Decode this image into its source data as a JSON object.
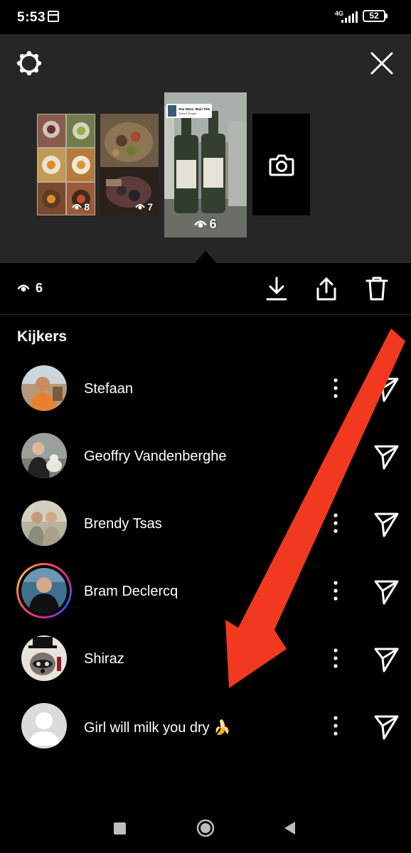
{
  "status_bar": {
    "time": "5:53",
    "network": "4G",
    "battery": "52"
  },
  "story_strip": {
    "thumbnails": [
      {
        "views": "8"
      },
      {
        "views": "7"
      },
      {
        "views": "6",
        "music_title": "Star Wars: Main Title",
        "music_artist": "Robert Ziegler"
      }
    ]
  },
  "toolbar": {
    "views": "6",
    "actions": [
      "download-icon",
      "share-icon",
      "trash-icon"
    ]
  },
  "viewers": {
    "title": "Kijkers",
    "items": [
      {
        "name": "Stefaan"
      },
      {
        "name": "Geoffry Vandenberghe"
      },
      {
        "name": "Brendy Tsas"
      },
      {
        "name": "Bram Declercq"
      },
      {
        "name": "Shiraz"
      },
      {
        "name": "Girl will milk you dry 🍌"
      }
    ]
  },
  "colors": {
    "panel": "#262626",
    "background": "#000000",
    "annotation_arrow": "#f0391f"
  }
}
